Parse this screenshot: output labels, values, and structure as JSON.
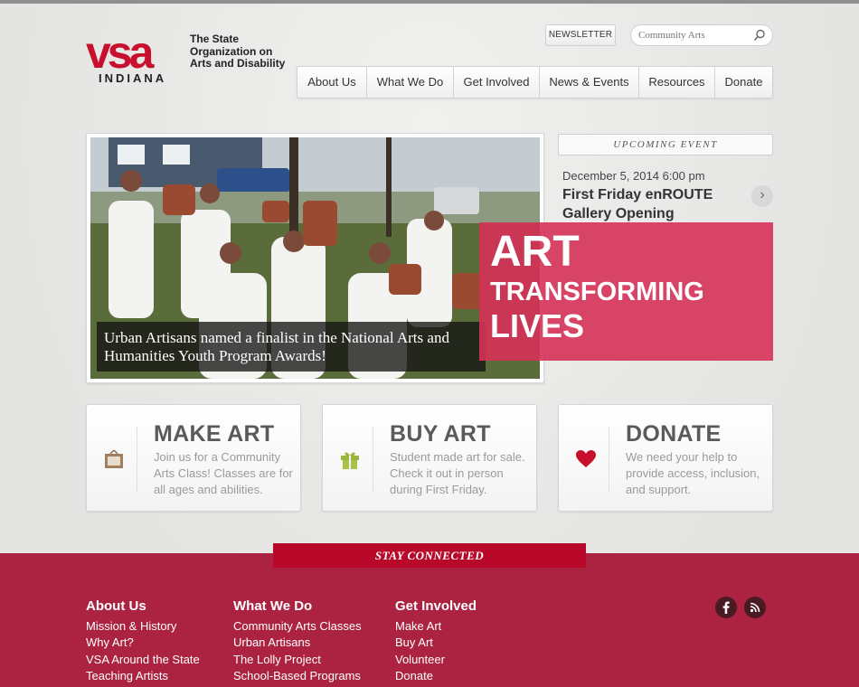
{
  "logo": {
    "mark": "vsa",
    "subtitle": "INDIANA",
    "tagline": "The State Organization on Arts and Disability",
    "brand_color": "#c8102e"
  },
  "header": {
    "newsletter_label": "NEWSLETTER",
    "search_placeholder": "Community Arts",
    "search_icon": "search-icon"
  },
  "nav": {
    "items": [
      "About Us",
      "What We Do",
      "Get Involved",
      "News & Events",
      "Resources",
      "Donate"
    ]
  },
  "hero": {
    "caption": "Urban Artisans named a finalist in the National Arts and Humanities Youth Program Awards!",
    "tagline_1": "ART",
    "tagline_2": "TRANSFORMING",
    "tagline_3": "LIVES",
    "tagline_color": "#d63258"
  },
  "event": {
    "ribbon": "UPCOMING EVENT",
    "date": "December 5, 2014 6:00 pm",
    "title": "First Friday enROUTE Gallery Opening",
    "next_icon": "chevron-right-icon"
  },
  "cards": [
    {
      "title": "MAKE ART",
      "body": "Join us for a Community Arts Class! Classes are for all ages and abilities.",
      "icon": "easel-icon"
    },
    {
      "title": "BUY ART",
      "body": "Student made art for sale. Check it out in person during First Friday.",
      "icon": "gift-icon"
    },
    {
      "title": "DONATE",
      "body": "We need your help to provide access, inclusion, and support.",
      "icon": "heart-icon"
    }
  ],
  "footer": {
    "ribbon": "STAY CONNECTED",
    "color": "#ab2340",
    "columns": [
      {
        "heading": "About Us",
        "links": [
          "Mission & History",
          "Why Art?",
          "VSA Around the State",
          "Teaching Artists"
        ]
      },
      {
        "heading": "What We Do",
        "links": [
          "Community Arts Classes",
          "Urban Artisans",
          "The Lolly Project",
          "School-Based Programs"
        ]
      },
      {
        "heading": "Get Involved",
        "links": [
          "Make Art",
          "Buy Art",
          "Volunteer",
          "Donate"
        ]
      }
    ],
    "social": [
      "facebook-icon",
      "rss-icon"
    ]
  }
}
